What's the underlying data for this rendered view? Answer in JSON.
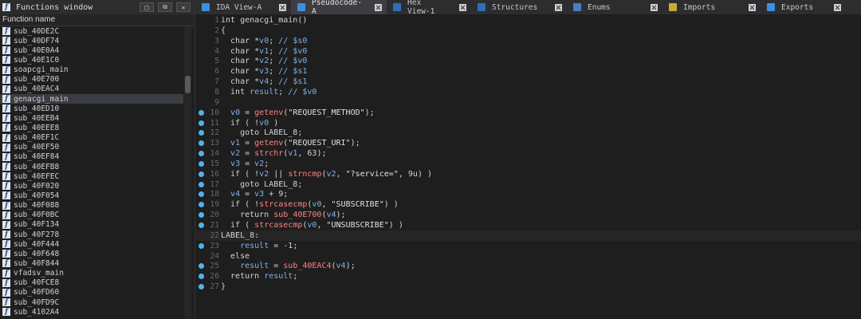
{
  "functions_window": {
    "title": "Functions window",
    "column_header": "Function name",
    "items": [
      "sub_40DE2C",
      "sub_40DF74",
      "sub_40E0A4",
      "sub_40E1C0",
      "soapcgi_main",
      "sub_40E700",
      "sub_40EAC4",
      "genacgi_main",
      "sub_40ED10",
      "sub_40EEB4",
      "sub_40EEE8",
      "sub_40EF1C",
      "sub_40EF50",
      "sub_40EF84",
      "sub_40EFB8",
      "sub_40EFEC",
      "sub_40F020",
      "sub_40F054",
      "sub_40F088",
      "sub_40F0BC",
      "sub_40F134",
      "sub_40F278",
      "sub_40F444",
      "sub_40F648",
      "sub_40F844",
      "vfadsv_main",
      "sub_40FCE8",
      "sub_40FD60",
      "sub_40FD9C",
      "sub_4102A4"
    ],
    "selected_index": 7
  },
  "tabs": [
    {
      "label": "IDA View-A",
      "icon_color": "#3d8fe0"
    },
    {
      "label": "Pseudocode-A",
      "icon_color": "#3d8fe0",
      "active": true
    },
    {
      "label": "Hex View-1",
      "icon_color": "#2f6fb5"
    },
    {
      "label": "Structures",
      "icon_color": "#2f6fb5"
    },
    {
      "label": "Enums",
      "icon_color": "#4a7fc0"
    },
    {
      "label": "Imports",
      "icon_color": "#c9a83a"
    },
    {
      "label": "Exports",
      "icon_color": "#3d8fe0"
    }
  ],
  "code": {
    "lines": [
      {
        "n": "1",
        "t": "int genacgi_main()"
      },
      {
        "n": "2",
        "t": "{"
      },
      {
        "n": "3",
        "t": "  char *v0; // $s0"
      },
      {
        "n": "4",
        "t": "  char *v1; // $v0"
      },
      {
        "n": "5",
        "t": "  char *v2; // $v0"
      },
      {
        "n": "6",
        "t": "  char *v3; // $s1"
      },
      {
        "n": "7",
        "t": "  char *v4; // $s1"
      },
      {
        "n": "8",
        "t": "  int result; // $v0"
      },
      {
        "n": "9",
        "t": ""
      },
      {
        "n": "10",
        "t": "  v0 = getenv(\"REQUEST_METHOD\");",
        "bp": true
      },
      {
        "n": "11",
        "t": "  if ( !v0 )",
        "bp": true
      },
      {
        "n": "12",
        "t": "    goto LABEL_8;",
        "bp": true
      },
      {
        "n": "13",
        "t": "  v1 = getenv(\"REQUEST_URI\");",
        "bp": true
      },
      {
        "n": "14",
        "t": "  v2 = strchr(v1, 63);",
        "bp": true
      },
      {
        "n": "15",
        "t": "  v3 = v2;",
        "bp": true
      },
      {
        "n": "16",
        "t": "  if ( !v2 || strncmp(v2, \"?service=\", 9u) )",
        "bp": true
      },
      {
        "n": "17",
        "t": "    goto LABEL_8;",
        "bp": true
      },
      {
        "n": "18",
        "t": "  v4 = v3 + 9;",
        "bp": true
      },
      {
        "n": "19",
        "t": "  if ( !strcasecmp(v0, \"SUBSCRIBE\") )",
        "bp": true
      },
      {
        "n": "20",
        "t": "    return sub_40E700(v4);",
        "bp": true
      },
      {
        "n": "21",
        "t": "  if ( strcasecmp(v0, \"UNSUBSCRIBE\") )",
        "bp": true
      },
      {
        "n": "22",
        "t": "LABEL_8:",
        "hl": true
      },
      {
        "n": "23",
        "t": "    result = -1;",
        "bp": true
      },
      {
        "n": "24",
        "t": "  else"
      },
      {
        "n": "25",
        "t": "    result = sub_40EAC4(v4);",
        "bp": true
      },
      {
        "n": "26",
        "t": "  return result;",
        "bp": true
      },
      {
        "n": "27",
        "t": "}",
        "bp": true
      }
    ]
  }
}
